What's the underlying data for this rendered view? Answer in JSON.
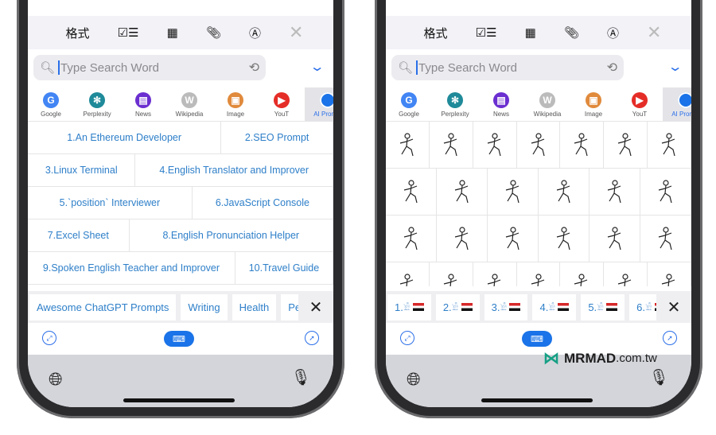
{
  "toolbar": {
    "format_label": "格式",
    "checklist_icon": "checklist-icon",
    "table_icon": "table-icon",
    "attach_icon": "paperclip-icon",
    "markup_icon": "pen-markup-icon",
    "close_icon": "close-icon"
  },
  "search": {
    "placeholder": "Type Search Word"
  },
  "sources": [
    {
      "label": "Google",
      "color": "#4285f4",
      "glyph": "G"
    },
    {
      "label": "Perplexity",
      "color": "#1f8a99",
      "glyph": "✻"
    },
    {
      "label": "News",
      "color": "#6b2fd0",
      "glyph": "▤"
    },
    {
      "label": "Wikipedia",
      "color": "#bbbbbb",
      "glyph": "W"
    },
    {
      "label": "Image",
      "color": "#e08a3c",
      "glyph": "▣"
    },
    {
      "label": "YouT",
      "color": "#e52d27",
      "glyph": "▶"
    }
  ],
  "active_source": {
    "label": "AI Prompt",
    "color": "#1a73e8"
  },
  "left": {
    "prompts": [
      [
        "1.An Ethereum Developer",
        "2.SEO Prompt"
      ],
      [
        "3.Linux Terminal",
        "4.English Translator and Improver"
      ],
      [
        "5.`position` Interviewer",
        "6.JavaScript Console"
      ],
      [
        "7.Excel Sheet",
        "8.English Pronunciation Helper"
      ],
      [
        "9.Spoken English Teacher and Improver",
        "10.Travel Guide"
      ]
    ],
    "tags": [
      "Awesome ChatGPT Prompts",
      "Writing",
      "Health",
      "Pers"
    ]
  },
  "right": {
    "hieroglyph_rows": [
      7,
      6,
      6,
      7
    ],
    "tags": [
      "1.",
      "2.",
      "3.",
      "4.",
      "5.",
      "6."
    ]
  },
  "watermark": {
    "brand": "MRMAD",
    ".suffix": ".com.tw",
    "suffix": ".com.tw"
  },
  "colors": {
    "accent": "#1a73e8",
    "link": "#2e7fc9"
  }
}
